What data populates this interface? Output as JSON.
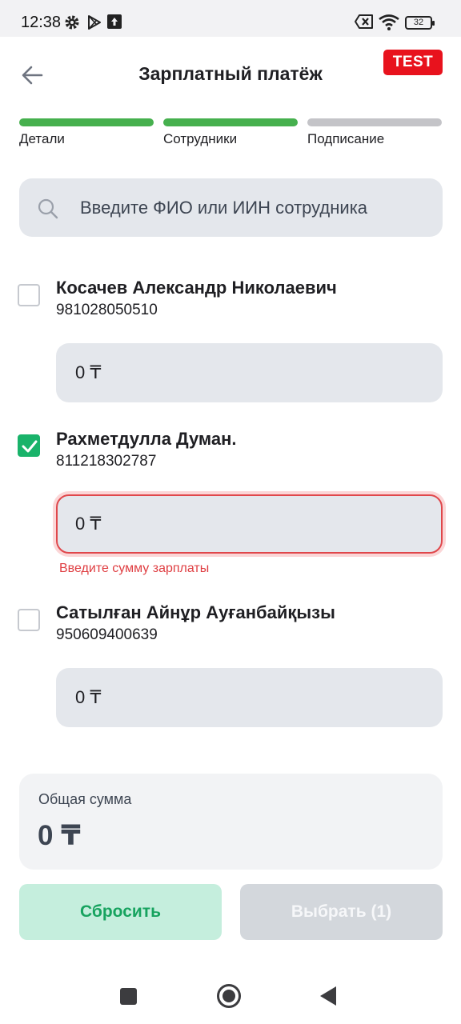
{
  "status_bar": {
    "time": "12:38",
    "battery": "32",
    "icons": [
      "gear-icon",
      "play-store-icon",
      "upload-icon",
      "sim-error-icon",
      "wifi-icon",
      "battery-icon"
    ]
  },
  "header": {
    "title": "Зарплатный платёж",
    "badge": "TEST"
  },
  "stepper": {
    "steps": [
      {
        "label": "Детали",
        "state": "done"
      },
      {
        "label": "Сотрудники",
        "state": "done"
      },
      {
        "label": "Подписание",
        "state": "todo"
      }
    ]
  },
  "search": {
    "placeholder": "Введите ФИО или ИИН сотрудника"
  },
  "employees": [
    {
      "name": "Косачев Александр Николаевич",
      "iin": "981028050510",
      "checked": false,
      "amount": "0 ₸",
      "error": ""
    },
    {
      "name": "Рахметдулла Думан.",
      "iin": "811218302787",
      "checked": true,
      "amount": "0 ₸",
      "error": "Введите сумму зарплаты"
    },
    {
      "name": "Сатылған Айнұр Ауғанбайқызы",
      "iin": "950609400639",
      "checked": false,
      "amount": "0 ₸",
      "error": ""
    }
  ],
  "total": {
    "label": "Общая сумма",
    "value": "0 ₸"
  },
  "buttons": {
    "reset": "Сбросить",
    "select": "Выбрать (1)"
  },
  "colors": {
    "accent_green": "#19b36a",
    "step_done": "#46b04e",
    "error_red": "#df3e42",
    "test_badge": "#e8121d"
  }
}
